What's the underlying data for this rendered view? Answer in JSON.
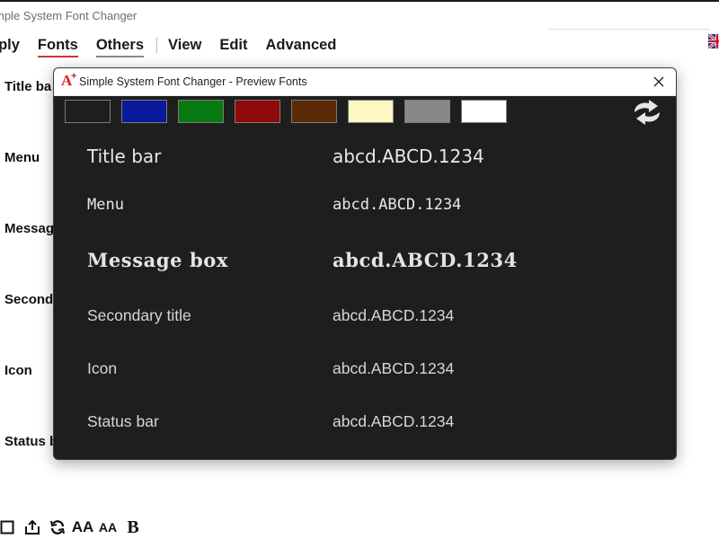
{
  "main_window": {
    "title": "mple System Font Changer",
    "menu": [
      "pply",
      "Fonts",
      "Others",
      "View",
      "Edit",
      "Advanced"
    ],
    "side_labels": [
      "Title ba",
      "Menu",
      "Messag",
      "Second",
      "Icon",
      "Status b"
    ],
    "bottom_toolbar": {
      "icons": [
        "save-icon",
        "export-icon",
        "refresh-icon",
        "font-large-icon",
        "font-small-icon",
        "bold-icon"
      ],
      "large_font_label": "AA",
      "small_font_label": "AA",
      "bold_label": "B"
    },
    "language_flag": "uk-flag-icon"
  },
  "preview_dialog": {
    "title": "Simple System Font Changer - Preview Fonts",
    "app_icon": {
      "glyph": "A",
      "superscript": "+"
    },
    "swatches": [
      "#1e1e1e",
      "#0a1a9a",
      "#087a12",
      "#8e0a0a",
      "#5a2a06",
      "#fdf8c2",
      "#888888",
      "#ffffff"
    ],
    "rows": [
      {
        "label": "Title bar",
        "sample": "abcd.ABCD.1234"
      },
      {
        "label": "Menu",
        "sample": "abcd.ABCD.1234"
      },
      {
        "label": "Message box",
        "sample": "abcd.ABCD.1234"
      },
      {
        "label": "Secondary title",
        "sample": "abcd.ABCD.1234"
      },
      {
        "label": "Icon",
        "sample": "abcd.ABCD.1234"
      },
      {
        "label": "Status bar",
        "sample": "abcd.ABCD.1234"
      }
    ]
  },
  "colors": {
    "dialog_bg": "#1e1e1e",
    "accent_red": "#d83434",
    "app_icon_red": "#d3201f"
  }
}
